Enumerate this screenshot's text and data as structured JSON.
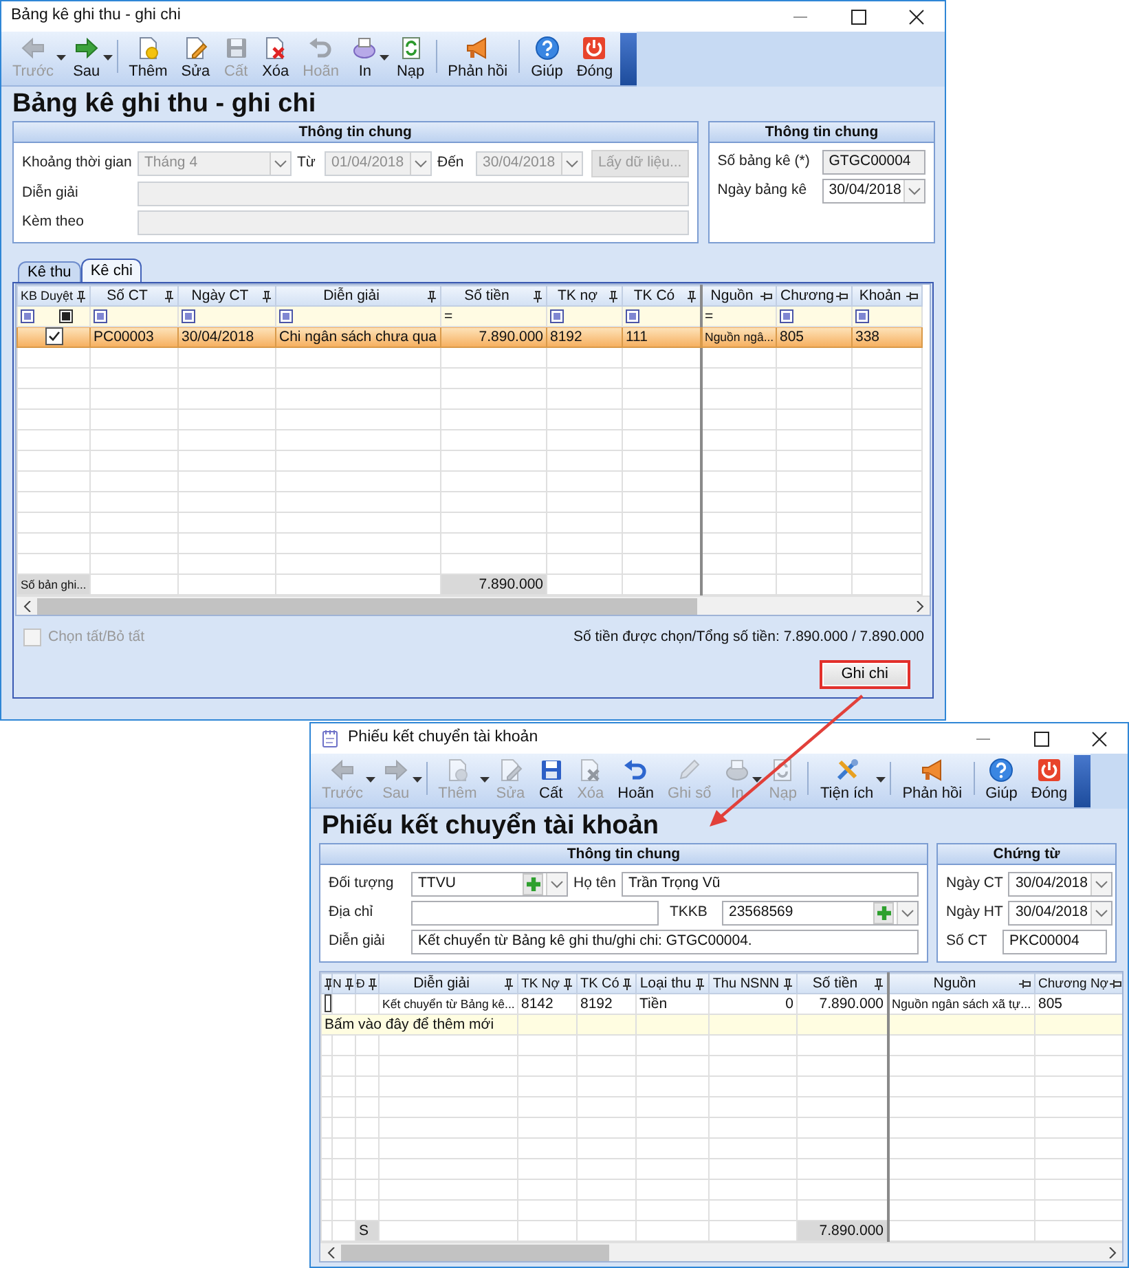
{
  "statement_window": {
    "title": "Bảng kê ghi thu - ghi chi",
    "toolbar": [
      {
        "label": "Trước",
        "kind": "back",
        "disabled": true,
        "dropdown": true
      },
      {
        "label": "Sau",
        "kind": "forward",
        "disabled": false,
        "dropdown": true
      },
      {
        "kind": "separator"
      },
      {
        "label": "Thêm",
        "kind": "add",
        "disabled": false,
        "dropdown": false
      },
      {
        "label": "Sửa",
        "kind": "edit",
        "disabled": false,
        "dropdown": false
      },
      {
        "label": "Cất",
        "kind": "save",
        "disabled": true,
        "dropdown": false
      },
      {
        "label": "Xóa",
        "kind": "delete",
        "disabled": false,
        "dropdown": false
      },
      {
        "label": "Hoãn",
        "kind": "undo",
        "disabled": true,
        "dropdown": false
      },
      {
        "label": "In",
        "kind": "print",
        "disabled": false,
        "dropdown": true
      },
      {
        "label": "Nạp",
        "kind": "reload",
        "disabled": false,
        "dropdown": false
      },
      {
        "kind": "separator"
      },
      {
        "label": "Phản hồi",
        "kind": "feedback",
        "disabled": false,
        "dropdown": false
      },
      {
        "kind": "separator"
      },
      {
        "label": "Giúp",
        "kind": "help",
        "disabled": false,
        "dropdown": false
      },
      {
        "label": "Đóng",
        "kind": "close",
        "disabled": false,
        "dropdown": false
      }
    ],
    "heading": "Bảng kê ghi thu - ghi chi",
    "general": {
      "title": "Thông tin chung",
      "period_label": "Khoảng thời gian",
      "period": {
        "value": "Tháng 4",
        "disabled": true
      },
      "from_label": "Từ",
      "from": {
        "value": "01/04/2018",
        "disabled": true
      },
      "to_label": "Đến",
      "to": {
        "value": "30/04/2018",
        "disabled": true
      },
      "fetch_button": {
        "label": "Lấy dữ liệu...",
        "disabled": true
      },
      "description_label": "Diễn giải",
      "attached_label": "Kèm theo"
    },
    "document": {
      "title": "Thông tin chung",
      "number_label": "Số bảng kê (*)",
      "number": "GTGC00004",
      "date_label": "Ngày bảng kê",
      "date": "30/04/2018"
    },
    "tabs": [
      {
        "label": "Kê thu",
        "selected": false
      },
      {
        "label": "Kê chi",
        "selected": true
      }
    ],
    "grid": {
      "columns": [
        {
          "label": "KB Duyệt",
          "kind": "check",
          "pinned": false,
          "filter": {
            "kind": "check"
          },
          "footer": "Số bản ghi..."
        },
        {
          "label": "Số CT",
          "kind": "text",
          "pinned": false,
          "filter": {
            "kind": "box"
          }
        },
        {
          "label": "Ngày CT",
          "kind": "text",
          "pinned": false,
          "filter": {
            "kind": "box"
          }
        },
        {
          "label": "Diễn giải",
          "kind": "text",
          "pinned": false,
          "filter": {
            "kind": "box"
          }
        },
        {
          "label": "Số tiền",
          "kind": "amount",
          "pinned": false,
          "filter": {
            "kind": "op",
            "text": "="
          },
          "footer": "7.890.000"
        },
        {
          "label": "TK nợ",
          "kind": "text",
          "pinned": false,
          "filter": {
            "kind": "box"
          }
        },
        {
          "label": "TK Có",
          "kind": "text",
          "pinned": false,
          "filter": {
            "kind": "box"
          }
        },
        {
          "label": "Nguồn",
          "kind": "text",
          "pinned": true,
          "filter": {
            "kind": "op",
            "text": "="
          }
        },
        {
          "label": "Chương",
          "kind": "text",
          "pinned": true,
          "filter": {
            "kind": "box"
          }
        },
        {
          "label": "Khoản",
          "kind": "text",
          "pinned": true,
          "filter": {
            "kind": "box"
          }
        }
      ],
      "rows": [
        {
          "selected": true,
          "approved": true,
          "cells": [
            "",
            "PC00003",
            "30/04/2018",
            "Chi ngân sách chưa qua",
            "7.890.000",
            "8192",
            "111",
            "Nguồn ngâ...",
            "805",
            "338"
          ]
        }
      ]
    },
    "select_all": {
      "label": "Chọn tất/Bỏ tất",
      "checked": false,
      "disabled": true
    },
    "total": "Số tiền được chọn/Tổng số tiền: 7.890.000  / 7.890.000",
    "action_button": {
      "label": "Ghi chi",
      "highlighted": true
    }
  },
  "transfer_window": {
    "title": "Phiếu kết chuyển tài khoản",
    "toolbar": [
      {
        "label": "Trước",
        "kind": "back",
        "disabled": true,
        "dropdown": true
      },
      {
        "label": "Sau",
        "kind": "forward",
        "disabled": true,
        "dropdown": true
      },
      {
        "kind": "separator"
      },
      {
        "label": "Thêm",
        "kind": "add",
        "disabled": true,
        "dropdown": true
      },
      {
        "label": "Sửa",
        "kind": "edit",
        "disabled": true,
        "dropdown": false
      },
      {
        "label": "Cất",
        "kind": "save",
        "disabled": false,
        "dropdown": false
      },
      {
        "label": "Xóa",
        "kind": "delete",
        "disabled": true,
        "dropdown": false
      },
      {
        "label": "Hoãn",
        "kind": "undo",
        "disabled": false,
        "dropdown": false
      },
      {
        "label": "Ghi sổ",
        "kind": "post",
        "disabled": true,
        "dropdown": false
      },
      {
        "label": "In",
        "kind": "print",
        "disabled": true,
        "dropdown": true
      },
      {
        "label": "Nạp",
        "kind": "reload",
        "disabled": true,
        "dropdown": false
      },
      {
        "kind": "separator"
      },
      {
        "label": "Tiện ích",
        "kind": "utility",
        "disabled": false,
        "dropdown": true
      },
      {
        "kind": "separator"
      },
      {
        "label": "Phản hồi",
        "kind": "feedback",
        "disabled": false,
        "dropdown": false
      },
      {
        "kind": "separator"
      },
      {
        "label": "Giúp",
        "kind": "help",
        "disabled": false,
        "dropdown": false
      },
      {
        "label": "Đóng",
        "kind": "close",
        "disabled": false,
        "dropdown": false
      }
    ],
    "heading": "Phiếu kết chuyển tài khoản",
    "general": {
      "title": "Thông tin chung",
      "object_label": "Đối tượng",
      "object": "TTVU",
      "name_label": "Họ tên",
      "name": "Trần Trọng Vũ",
      "address_label": "Địa chỉ",
      "account_label": "TKKB",
      "account": "23568569",
      "description_label": "Diễn giải",
      "description": "Kết chuyển từ Bảng kê ghi thu/ghi chi: GTGC00004."
    },
    "voucher": {
      "title": "Chứng từ",
      "doc_date_label": "Ngày CT",
      "doc_date": "30/04/2018",
      "post_date_label": "Ngày HT",
      "post_date": "30/04/2018",
      "number_label": "Số CT",
      "number": "PKC00004"
    },
    "grid": {
      "columns": [
        {
          "kind": "indicator",
          "pinned": false
        },
        {
          "label": "N",
          "kind": "flag",
          "pinned": false
        },
        {
          "label": "Đ",
          "kind": "flag",
          "pinned": false,
          "footer": "S"
        },
        {
          "label": "Diễn giải",
          "kind": "text",
          "pinned": false
        },
        {
          "label": "TK Nợ",
          "kind": "text",
          "pinned": false
        },
        {
          "label": "TK Có",
          "kind": "text",
          "pinned": false
        },
        {
          "label": "Loại thu",
          "kind": "text",
          "pinned": false
        },
        {
          "label": "Thu NSNN",
          "kind": "amount",
          "pinned": false
        },
        {
          "label": "Số tiền",
          "kind": "amount",
          "pinned": false,
          "footer": "7.890.000"
        },
        {
          "label": "Nguồn",
          "kind": "text",
          "pinned": true
        },
        {
          "label": "Chương Nợ",
          "kind": "text",
          "pinned": true
        }
      ],
      "rows": [
        {
          "current": true,
          "cells": [
            "",
            "",
            "",
            "Kết chuyển từ Bảng kê...",
            "8142",
            "8192",
            "Tiền",
            "0",
            "7.890.000",
            "Nguồn ngân sách xã tự...",
            "805"
          ]
        }
      ],
      "new_row_hint": "Bấm vào đây để thêm mới"
    }
  }
}
